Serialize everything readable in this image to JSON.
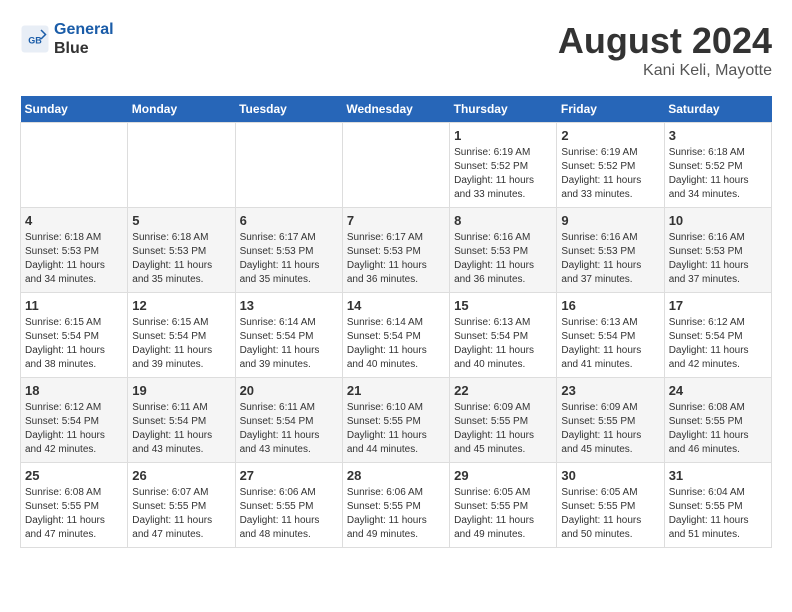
{
  "header": {
    "logo_line1": "General",
    "logo_line2": "Blue",
    "title": "August 2024",
    "subtitle": "Kani Keli, Mayotte"
  },
  "weekdays": [
    "Sunday",
    "Monday",
    "Tuesday",
    "Wednesday",
    "Thursday",
    "Friday",
    "Saturday"
  ],
  "weeks": [
    {
      "days": [
        {
          "num": "",
          "info": ""
        },
        {
          "num": "",
          "info": ""
        },
        {
          "num": "",
          "info": ""
        },
        {
          "num": "",
          "info": ""
        },
        {
          "num": "1",
          "info": "Sunrise: 6:19 AM\nSunset: 5:52 PM\nDaylight: 11 hours\nand 33 minutes."
        },
        {
          "num": "2",
          "info": "Sunrise: 6:19 AM\nSunset: 5:52 PM\nDaylight: 11 hours\nand 33 minutes."
        },
        {
          "num": "3",
          "info": "Sunrise: 6:18 AM\nSunset: 5:52 PM\nDaylight: 11 hours\nand 34 minutes."
        }
      ]
    },
    {
      "days": [
        {
          "num": "4",
          "info": "Sunrise: 6:18 AM\nSunset: 5:53 PM\nDaylight: 11 hours\nand 34 minutes."
        },
        {
          "num": "5",
          "info": "Sunrise: 6:18 AM\nSunset: 5:53 PM\nDaylight: 11 hours\nand 35 minutes."
        },
        {
          "num": "6",
          "info": "Sunrise: 6:17 AM\nSunset: 5:53 PM\nDaylight: 11 hours\nand 35 minutes."
        },
        {
          "num": "7",
          "info": "Sunrise: 6:17 AM\nSunset: 5:53 PM\nDaylight: 11 hours\nand 36 minutes."
        },
        {
          "num": "8",
          "info": "Sunrise: 6:16 AM\nSunset: 5:53 PM\nDaylight: 11 hours\nand 36 minutes."
        },
        {
          "num": "9",
          "info": "Sunrise: 6:16 AM\nSunset: 5:53 PM\nDaylight: 11 hours\nand 37 minutes."
        },
        {
          "num": "10",
          "info": "Sunrise: 6:16 AM\nSunset: 5:53 PM\nDaylight: 11 hours\nand 37 minutes."
        }
      ]
    },
    {
      "days": [
        {
          "num": "11",
          "info": "Sunrise: 6:15 AM\nSunset: 5:54 PM\nDaylight: 11 hours\nand 38 minutes."
        },
        {
          "num": "12",
          "info": "Sunrise: 6:15 AM\nSunset: 5:54 PM\nDaylight: 11 hours\nand 39 minutes."
        },
        {
          "num": "13",
          "info": "Sunrise: 6:14 AM\nSunset: 5:54 PM\nDaylight: 11 hours\nand 39 minutes."
        },
        {
          "num": "14",
          "info": "Sunrise: 6:14 AM\nSunset: 5:54 PM\nDaylight: 11 hours\nand 40 minutes."
        },
        {
          "num": "15",
          "info": "Sunrise: 6:13 AM\nSunset: 5:54 PM\nDaylight: 11 hours\nand 40 minutes."
        },
        {
          "num": "16",
          "info": "Sunrise: 6:13 AM\nSunset: 5:54 PM\nDaylight: 11 hours\nand 41 minutes."
        },
        {
          "num": "17",
          "info": "Sunrise: 6:12 AM\nSunset: 5:54 PM\nDaylight: 11 hours\nand 42 minutes."
        }
      ]
    },
    {
      "days": [
        {
          "num": "18",
          "info": "Sunrise: 6:12 AM\nSunset: 5:54 PM\nDaylight: 11 hours\nand 42 minutes."
        },
        {
          "num": "19",
          "info": "Sunrise: 6:11 AM\nSunset: 5:54 PM\nDaylight: 11 hours\nand 43 minutes."
        },
        {
          "num": "20",
          "info": "Sunrise: 6:11 AM\nSunset: 5:54 PM\nDaylight: 11 hours\nand 43 minutes."
        },
        {
          "num": "21",
          "info": "Sunrise: 6:10 AM\nSunset: 5:55 PM\nDaylight: 11 hours\nand 44 minutes."
        },
        {
          "num": "22",
          "info": "Sunrise: 6:09 AM\nSunset: 5:55 PM\nDaylight: 11 hours\nand 45 minutes."
        },
        {
          "num": "23",
          "info": "Sunrise: 6:09 AM\nSunset: 5:55 PM\nDaylight: 11 hours\nand 45 minutes."
        },
        {
          "num": "24",
          "info": "Sunrise: 6:08 AM\nSunset: 5:55 PM\nDaylight: 11 hours\nand 46 minutes."
        }
      ]
    },
    {
      "days": [
        {
          "num": "25",
          "info": "Sunrise: 6:08 AM\nSunset: 5:55 PM\nDaylight: 11 hours\nand 47 minutes."
        },
        {
          "num": "26",
          "info": "Sunrise: 6:07 AM\nSunset: 5:55 PM\nDaylight: 11 hours\nand 47 minutes."
        },
        {
          "num": "27",
          "info": "Sunrise: 6:06 AM\nSunset: 5:55 PM\nDaylight: 11 hours\nand 48 minutes."
        },
        {
          "num": "28",
          "info": "Sunrise: 6:06 AM\nSunset: 5:55 PM\nDaylight: 11 hours\nand 49 minutes."
        },
        {
          "num": "29",
          "info": "Sunrise: 6:05 AM\nSunset: 5:55 PM\nDaylight: 11 hours\nand 49 minutes."
        },
        {
          "num": "30",
          "info": "Sunrise: 6:05 AM\nSunset: 5:55 PM\nDaylight: 11 hours\nand 50 minutes."
        },
        {
          "num": "31",
          "info": "Sunrise: 6:04 AM\nSunset: 5:55 PM\nDaylight: 11 hours\nand 51 minutes."
        }
      ]
    }
  ]
}
